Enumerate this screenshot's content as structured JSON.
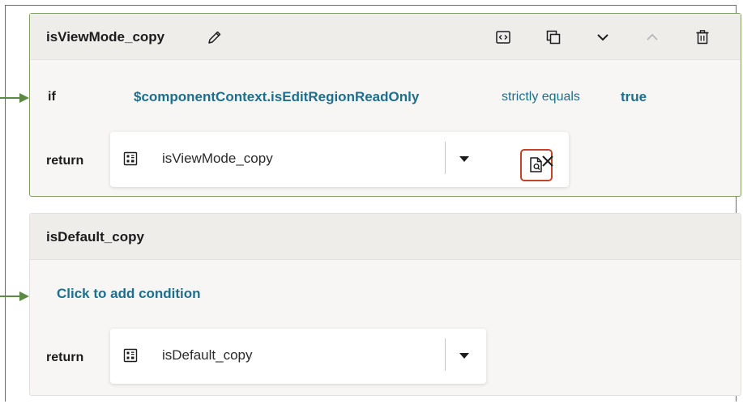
{
  "cards": [
    {
      "title": "isViewMode_copy",
      "condition": {
        "if_label": "if",
        "left": "$componentContext.isEditRegionReadOnly",
        "operator": "strictly equals",
        "right": "true"
      },
      "return": {
        "label": "return",
        "value": "isViewMode_copy"
      },
      "header_icons": [
        "code-icon",
        "duplicate-icon",
        "chevron-down-icon",
        "chevron-up-icon",
        "trash-icon"
      ],
      "return_icons": [
        "component-icon",
        "dropdown-caret-icon",
        "preview-document-icon",
        "close-icon"
      ]
    },
    {
      "title": "isDefault_copy",
      "add_condition_label": "Click to add condition",
      "return": {
        "label": "return",
        "value": "isDefault_copy"
      },
      "return_icons": [
        "component-icon",
        "dropdown-caret-icon"
      ]
    }
  ],
  "colors": {
    "accent_link": "#1d6f8e",
    "active_border": "#7e9f6a",
    "connector_green": "#5c8a45",
    "highlight_red": "#c4432b"
  }
}
